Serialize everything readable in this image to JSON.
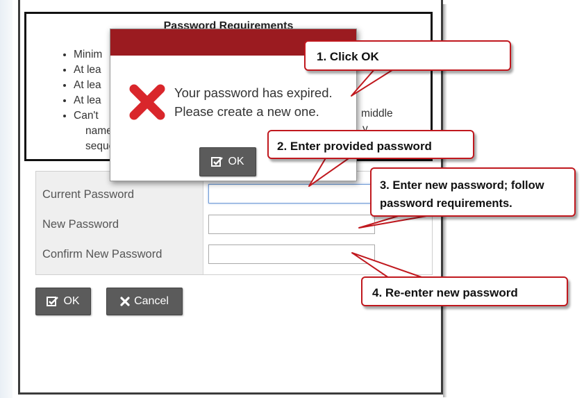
{
  "requirements": {
    "title": "Password Requirements",
    "items": [
      "Minim",
      "At lea",
      "At lea",
      "At lea",
      "Can't"
    ],
    "overflow_text": "middle",
    "wrap_lines": [
      "name",
      "seque"
    ],
    "trailing_fragment": "y"
  },
  "form": {
    "fields": [
      {
        "label": "Current Password",
        "value": ""
      },
      {
        "label": "New Password",
        "value": ""
      },
      {
        "label": "Confirm New Password",
        "value": ""
      }
    ],
    "ok_label": "OK",
    "cancel_label": "Cancel"
  },
  "modal": {
    "message_line1": "Your password has expired.",
    "message_line2": "Please create a new one.",
    "ok_label": "OK",
    "header_color": "#9b1b20",
    "icon": "x-icon"
  },
  "callouts": [
    {
      "text": "1. Click OK"
    },
    {
      "text": "2.  Enter provided password"
    },
    {
      "text": "3. Enter new password; follow password requirements."
    },
    {
      "text": "4. Re-enter new password"
    }
  ],
  "colors": {
    "callout_border": "#c0181e",
    "button_bg": "#5b5b5b",
    "error_icon": "#d9262b"
  }
}
